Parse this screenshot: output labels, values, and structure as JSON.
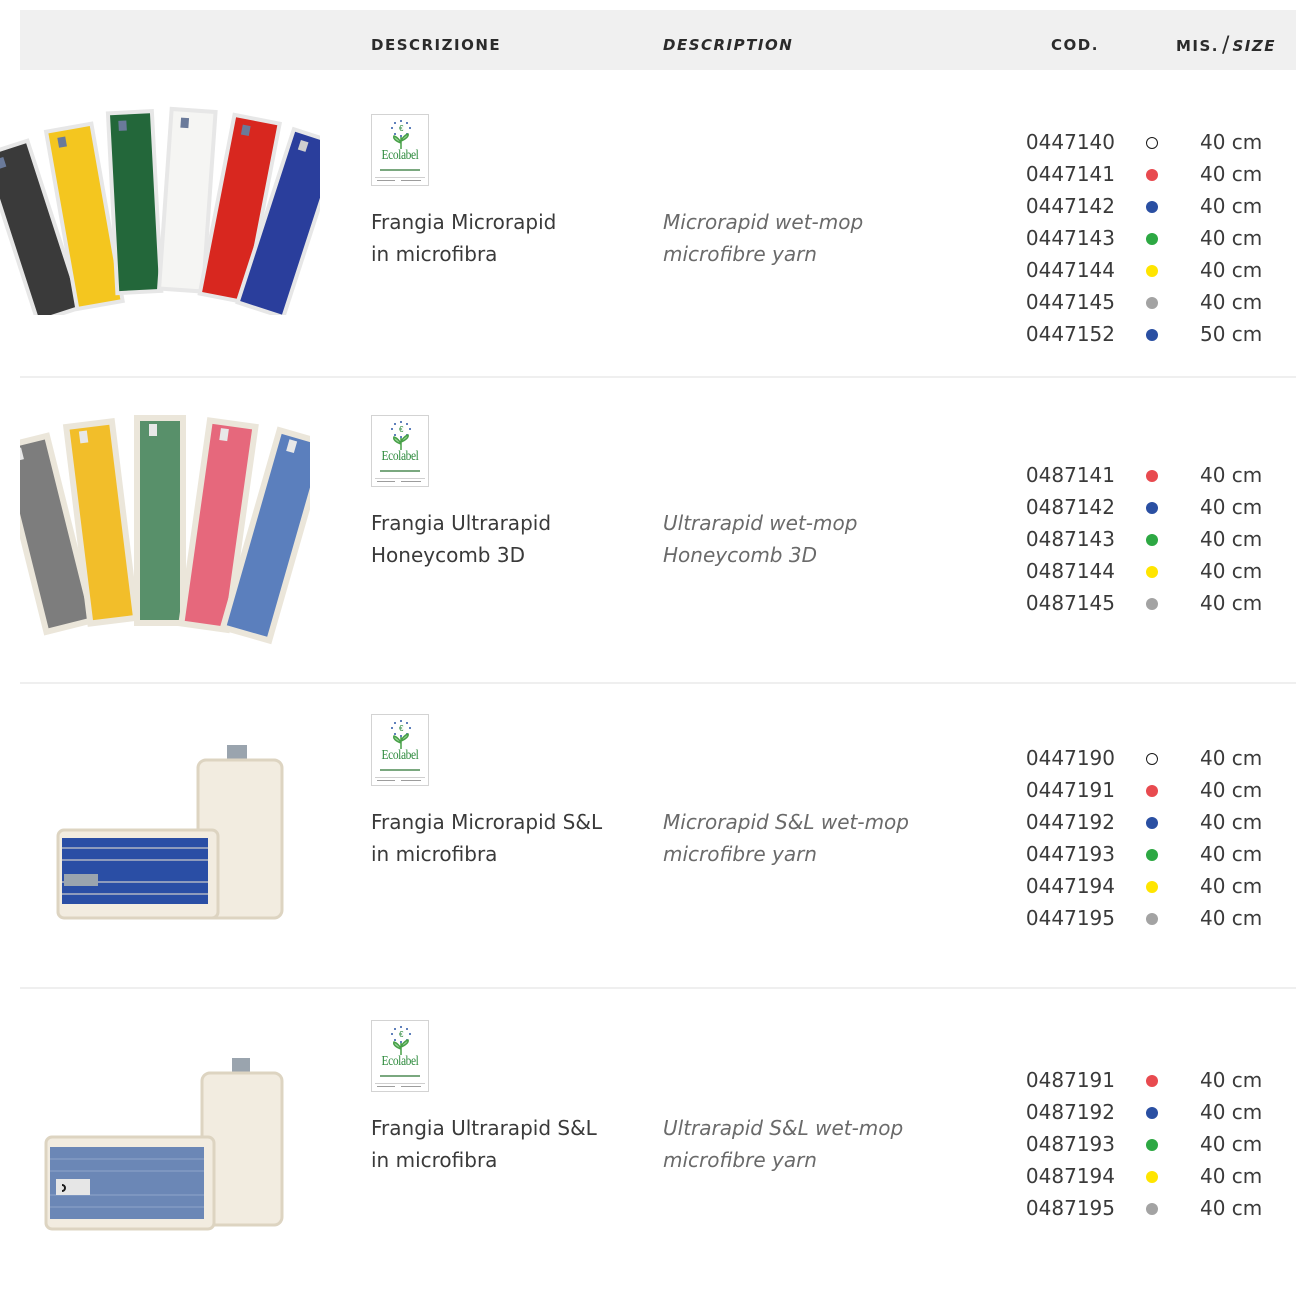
{
  "header": {
    "descrizione": "DESCRIZIONE",
    "description": "DESCRIPTION",
    "cod": "COD.",
    "mis": "MIS.",
    "slash": "/",
    "size": "SIZE"
  },
  "ecolabel": {
    "eu": "EU",
    "text": "Ecolabel"
  },
  "colors": {
    "white": "#ffffff",
    "red": "#e84a4f",
    "blue": "#2a4fa2",
    "green": "#2da843",
    "yellow": "#ffe500",
    "grey": "#a3a3a3"
  },
  "products": [
    {
      "name_it": [
        "Frangia Microrapid",
        "in microfibra"
      ],
      "name_en": [
        "Microrapid wet-mop",
        "microfibre yarn"
      ],
      "variants": [
        {
          "code": "0447140",
          "color": "white",
          "size": "40 cm"
        },
        {
          "code": "0447141",
          "color": "red",
          "size": "40 cm"
        },
        {
          "code": "0447142",
          "color": "blue",
          "size": "40 cm"
        },
        {
          "code": "0447143",
          "color": "green",
          "size": "40 cm"
        },
        {
          "code": "0447144",
          "color": "yellow",
          "size": "40 cm"
        },
        {
          "code": "0447145",
          "color": "grey",
          "size": "40 cm"
        },
        {
          "code": "0447152",
          "color": "blue",
          "size": "50 cm"
        }
      ]
    },
    {
      "name_it": [
        "Frangia Ultrarapid",
        "Honeycomb 3D"
      ],
      "name_en": [
        "Ultrarapid wet-mop",
        "Honeycomb 3D"
      ],
      "variants": [
        {
          "code": "0487141",
          "color": "red",
          "size": "40 cm"
        },
        {
          "code": "0487142",
          "color": "blue",
          "size": "40 cm"
        },
        {
          "code": "0487143",
          "color": "green",
          "size": "40 cm"
        },
        {
          "code": "0487144",
          "color": "yellow",
          "size": "40 cm"
        },
        {
          "code": "0487145",
          "color": "grey",
          "size": "40 cm"
        }
      ]
    },
    {
      "name_it": [
        "Frangia Microrapid S&L",
        "in microfibra"
      ],
      "name_en": [
        "Microrapid S&L wet-mop",
        "microfibre yarn"
      ],
      "variants": [
        {
          "code": "0447190",
          "color": "white",
          "size": "40 cm"
        },
        {
          "code": "0447191",
          "color": "red",
          "size": "40 cm"
        },
        {
          "code": "0447192",
          "color": "blue",
          "size": "40 cm"
        },
        {
          "code": "0447193",
          "color": "green",
          "size": "40 cm"
        },
        {
          "code": "0447194",
          "color": "yellow",
          "size": "40 cm"
        },
        {
          "code": "0447195",
          "color": "grey",
          "size": "40 cm"
        }
      ]
    },
    {
      "name_it": [
        "Frangia Ultrarapid S&L",
        "in microfibra"
      ],
      "name_en": [
        "Ultrarapid S&L wet-mop",
        "microfibre yarn"
      ],
      "variants": [
        {
          "code": "0487191",
          "color": "red",
          "size": "40 cm"
        },
        {
          "code": "0487192",
          "color": "blue",
          "size": "40 cm"
        },
        {
          "code": "0487193",
          "color": "green",
          "size": "40 cm"
        },
        {
          "code": "0487194",
          "color": "yellow",
          "size": "40 cm"
        },
        {
          "code": "0487195",
          "color": "grey",
          "size": "40 cm"
        }
      ]
    }
  ]
}
